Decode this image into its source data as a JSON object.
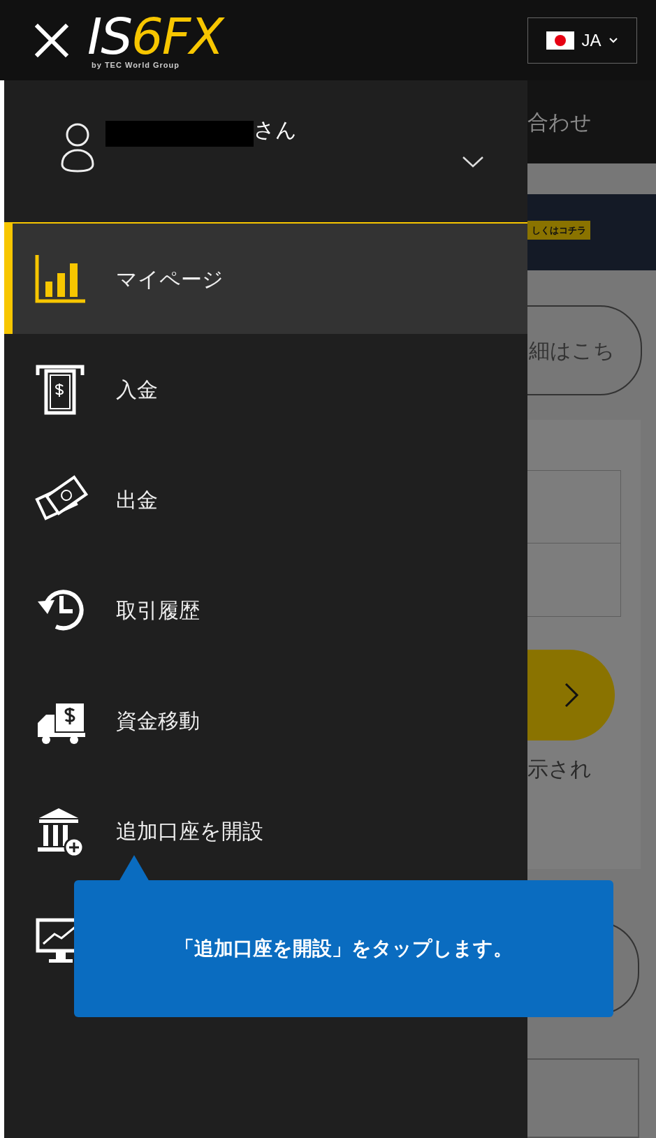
{
  "header": {
    "logo": {
      "main": "IS",
      "accent": "6FX",
      "tagline": "by TEC World Group"
    },
    "language": {
      "code": "JA"
    }
  },
  "drawer": {
    "user": {
      "name_redacted": true,
      "suffix": "さん"
    },
    "items": [
      {
        "kind": "chart",
        "label": "マイページ",
        "selected": true
      },
      {
        "kind": "deposit",
        "label": "入金",
        "selected": false
      },
      {
        "kind": "withdraw",
        "label": "出金",
        "selected": false
      },
      {
        "kind": "history",
        "label": "取引履歴",
        "selected": false
      },
      {
        "kind": "transfer",
        "label": "資金移動",
        "selected": false
      },
      {
        "kind": "bank",
        "label": "追加口座を開設",
        "selected": false
      },
      {
        "kind": "monitor",
        "selected": false
      }
    ]
  },
  "tooltip": {
    "text": "「追加口座を開設」をタップします。"
  },
  "background_page": {
    "nav_text": "合わせ",
    "banner_tag": "しくはコチラ",
    "button_text": "細はこち",
    "caption": "示され"
  }
}
